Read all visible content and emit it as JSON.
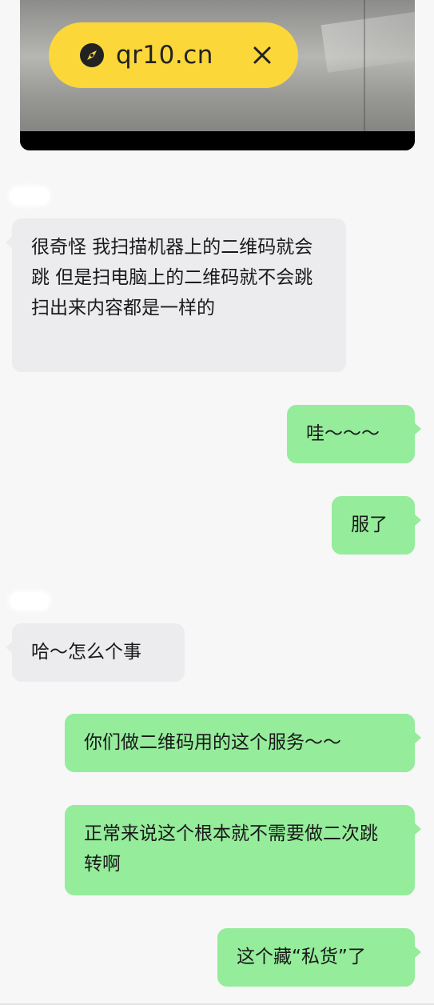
{
  "media": {
    "url_label": "qr10.cn",
    "icons": {
      "compass": "compass-icon",
      "close": "close-icon"
    },
    "pill_color": "#fbd73a"
  },
  "messages": [
    {
      "side": "in",
      "text": "很奇怪 我扫描机器上的二维码就会跳 但是扫电脑上的二维码就不会跳 扫出来内容都是一样的"
    },
    {
      "side": "out",
      "text": "哇～～～"
    },
    {
      "side": "out",
      "text": "服了"
    },
    {
      "side": "in",
      "text": "哈～怎么个事"
    },
    {
      "side": "out",
      "text": "你们做二维码用的这个服务～～"
    },
    {
      "side": "out",
      "text": "正常来说这个根本就不需要做二次跳转啊"
    },
    {
      "side": "out",
      "text": "这个藏“私货”了"
    }
  ],
  "colors": {
    "background": "#f7f7f7",
    "incoming_bubble": "#ececee",
    "outgoing_bubble": "#95ec9b"
  }
}
